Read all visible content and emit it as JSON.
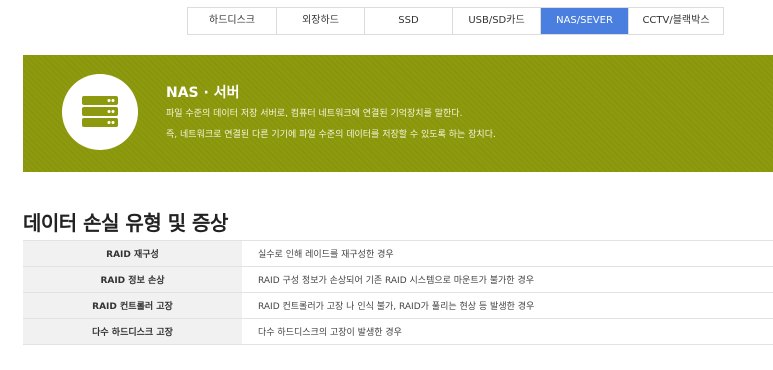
{
  "tabs": [
    {
      "label": "하드디스크",
      "active": false
    },
    {
      "label": "외장하드",
      "active": false
    },
    {
      "label": "SSD",
      "active": false
    },
    {
      "label": "USB/SD카드",
      "active": false
    },
    {
      "label": "NAS/SEVER",
      "active": true
    },
    {
      "label": "CCTV/블랙박스",
      "active": false
    }
  ],
  "banner": {
    "icon": "server-icon",
    "title": "NAS · 서버",
    "desc1": "파일 수준의 데이터 저장 서버로, 컴퓨터 네트워크에 연결된 기억장치를 말한다.",
    "desc2": "즉, 네트워크로 연결된 다른 기기에 파일 수준의 데이터를 저장할 수 있도록 하는 장치다."
  },
  "section": {
    "title": "데이터 손실 유형 및 증상"
  },
  "rows": [
    {
      "key": "RAID 재구성",
      "value": "실수로 인해 레이드를 재구성한 경우"
    },
    {
      "key": "RAID 정보 손상",
      "value": "RAID 구성 정보가 손상되어 기존 RAID 시스템으로 마운트가 불가한 경우"
    },
    {
      "key": "RAID 컨트롤러 고장",
      "value": "RAID 컨트롤러가 고장 나 인식 불가, RAID가 풀리는 현상 등 발생한 경우"
    },
    {
      "key": "다수 하드디스크 고장",
      "value": "다수 하드디스크의 고장이 발생한 경우"
    }
  ],
  "colors": {
    "tab_active": "#4a7fe0",
    "banner_bg": "#8e9a0e"
  }
}
